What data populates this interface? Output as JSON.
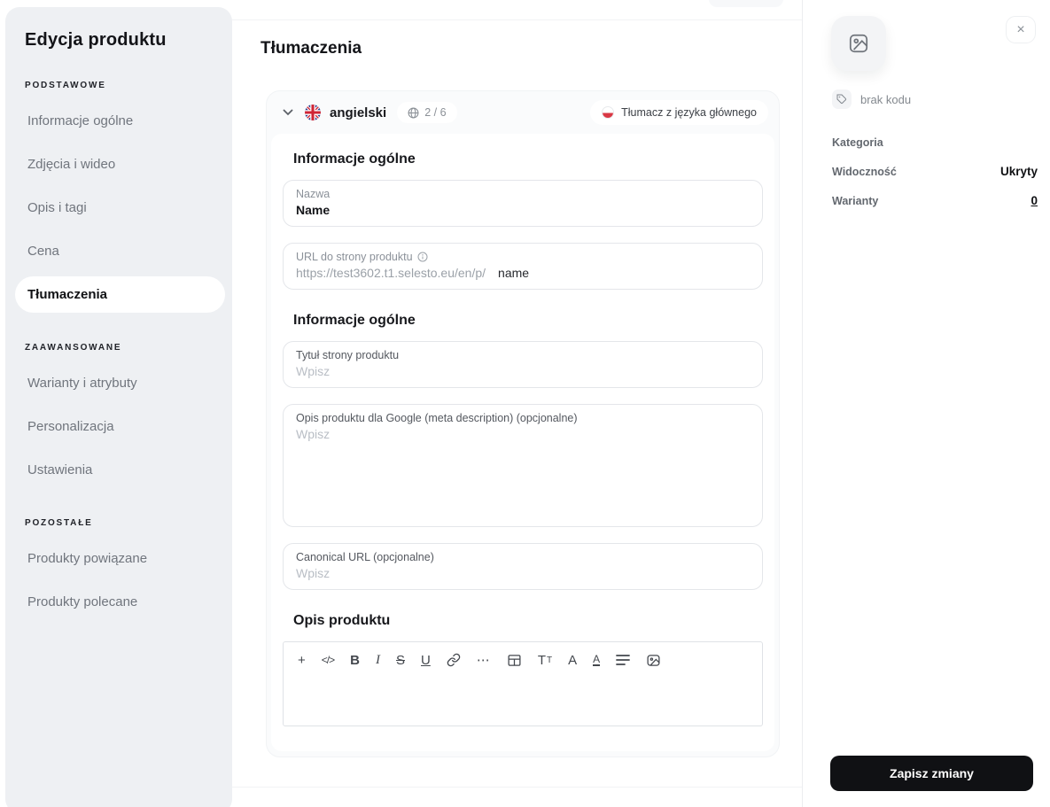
{
  "sidebar": {
    "title": "Edycja produktu",
    "sections": [
      {
        "label": "PODSTAWOWE",
        "items": [
          {
            "label": "Informacje ogólne"
          },
          {
            "label": "Zdjęcia i wideo"
          },
          {
            "label": "Opis i tagi"
          },
          {
            "label": "Cena"
          },
          {
            "label": "Tłumaczenia"
          }
        ]
      },
      {
        "label": "ZAAWANSOWANE",
        "items": [
          {
            "label": "Warianty i atrybuty"
          },
          {
            "label": "Personalizacja"
          },
          {
            "label": "Ustawienia"
          }
        ]
      },
      {
        "label": "POZOSTAŁE",
        "items": [
          {
            "label": "Produkty powiązane"
          },
          {
            "label": "Produkty polecane"
          }
        ]
      }
    ]
  },
  "main": {
    "title": "Tłumaczenia",
    "language_header": {
      "language": "angielski",
      "progress": "2 / 6",
      "translate_label": "Tłumacz z języka głównego"
    },
    "section_general_1": {
      "heading": "Informacje ogólne",
      "name_field": {
        "label": "Nazwa",
        "value": "Name"
      },
      "url_field": {
        "label": "URL do strony produktu",
        "prefix": "https://test3602.t1.selesto.eu/en/p/",
        "value": "name"
      }
    },
    "section_general_2": {
      "heading": "Informacje ogólne",
      "title_field": {
        "label": "Tytuł strony produktu",
        "placeholder": "Wpisz"
      },
      "meta_field": {
        "label": "Opis produktu dla Google (meta description) (opcjonalne)",
        "placeholder": "Wpisz"
      },
      "canonical_field": {
        "label": "Canonical URL (opcjonalne)",
        "placeholder": "Wpisz"
      }
    },
    "section_description": {
      "heading": "Opis produktu",
      "toolbar": {
        "plus": "+",
        "code": "</>",
        "bold": "B",
        "italic": "I",
        "strikethrough": "S",
        "underline": "U",
        "more": "⋯",
        "text_size_large": "T",
        "text_size_small": "T",
        "font": "A",
        "text_color": "A"
      }
    }
  },
  "panel": {
    "close_glyph": "×",
    "code_status": "brak kodu",
    "rows": [
      {
        "label": "Kategoria",
        "value": ""
      },
      {
        "label": "Widoczność",
        "value": "Ukryty"
      },
      {
        "label": "Warianty",
        "value": "0"
      }
    ],
    "save_label": "Zapisz zmiany"
  },
  "colors": {
    "save_button": "#101114",
    "poland_flag_red": "#d93844",
    "uk_flag_blue": "#283a8b",
    "uk_flag_red": "#cf2435"
  }
}
